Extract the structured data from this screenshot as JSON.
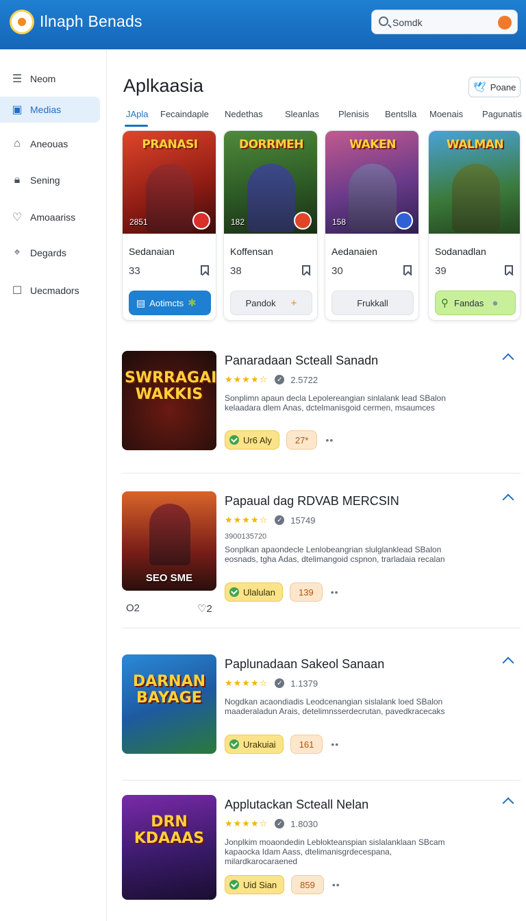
{
  "header": {
    "app_title": "Ilnaph Benads",
    "search_placeholder": "Somdk"
  },
  "sidebar": {
    "items": [
      {
        "label": "Neom",
        "icon": "menu-icon"
      },
      {
        "label": "Medias",
        "icon": "media-icon",
        "active": true
      },
      {
        "label": "Aneouas",
        "icon": "home-icon"
      },
      {
        "label": "Sening",
        "icon": "lock-icon"
      },
      {
        "label": "Amoaariss",
        "icon": "heart-icon"
      },
      {
        "label": "Degards",
        "icon": "tag-icon"
      },
      {
        "label": "Uecmadors",
        "icon": "checkbox-icon"
      }
    ]
  },
  "main": {
    "title": "Aplkaasia",
    "share_label": "Poane",
    "tabs": [
      "JApla",
      "Fecaindaple",
      "Nedethas",
      "Sleanlas",
      "Plenisis",
      "Bentslla",
      "Moenais",
      "Pagunatis"
    ],
    "active_tab": "JApla"
  },
  "cards": [
    {
      "thumb_text": "PRANASI",
      "thumb_count": "2851",
      "name": "Sedanaian",
      "number": "33",
      "action": "Aotimcts",
      "action_icon": "puzzle-icon"
    },
    {
      "thumb_text": "DORRMEH",
      "thumb_count": "182",
      "name": "Koffensan",
      "number": "38",
      "action": "Pandok",
      "action_icon": "plus-icon"
    },
    {
      "thumb_text": "WAKEN",
      "thumb_count": "158",
      "name": "Aedanaien",
      "number": "30",
      "action": "Frukkall",
      "action_icon": ""
    },
    {
      "thumb_text": "WALMAN",
      "thumb_count": "",
      "name": "Sodanadlan",
      "number": "39",
      "action": "Fandas",
      "action_icon": "search-icon"
    }
  ],
  "list": [
    {
      "thumb_text": "SWRRAGAI WAKKIS",
      "thumb_caption": "",
      "title": "Panaradaan Scteall Sanadn",
      "rating": "2.5722",
      "extra": "",
      "description": "Sonplimn apaun decla Lepolereangian sinlalank lead SBalon kelaadara dlem Anas, dctelmanisgoid cermen, msaumces",
      "tag": "Ur6 Aly",
      "count": "27*",
      "stats_left": "",
      "stats_right": ""
    },
    {
      "thumb_text": "",
      "thumb_caption": "SEO SME",
      "title": "Papaual dag RDVAB MERCSIN",
      "rating": "15749",
      "extra": "3900135720",
      "description": "Sonplkan apaondecle Lenlobeangrian slulglanklead SBalon eosnads, tgha Adas, dtelimangoid cspnon, trarladaia recalan",
      "tag": "Ulalulan",
      "count": "139",
      "stats_left": "O2",
      "stats_right": "♡2"
    },
    {
      "thumb_text": "DARNAN BAYAGE",
      "thumb_caption": "",
      "title": "Paplunadaan Sakeol Sanaan",
      "rating": "1.1379",
      "extra": "",
      "description": "Nogdkan acaondiadis Leodcenangian sislalank loed SBalon maaderaladun Arais, detelimnsserdecrutan, pavedkracecaks",
      "tag": "Urakuiai",
      "count": "161",
      "stats_left": "",
      "stats_right": ""
    },
    {
      "thumb_text": "DRN KDAAAS",
      "thumb_caption": "",
      "title": "Applutackan Scteall Nelan",
      "rating": "1.8030",
      "extra": "",
      "description": "Jonplkim moaondedin Leblokteanspian sislalanklaan SBcam kapaocka Idam Aass, dtelimanisgrdecespana, milardkarocaraened",
      "tag": "Uid Sian",
      "count": "859",
      "stats_left": "",
      "stats_right": ""
    }
  ]
}
